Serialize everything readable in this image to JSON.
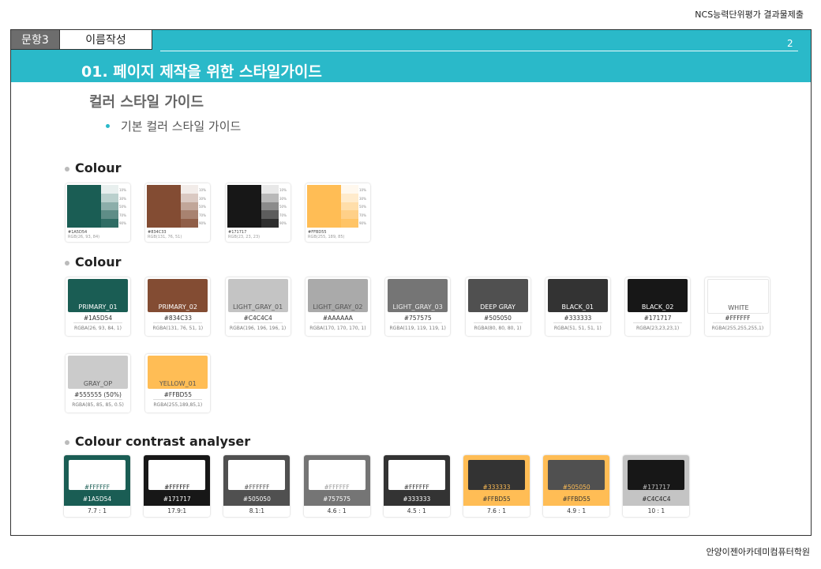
{
  "header": {
    "top_right": "NCS능력단위평가 결과물제출",
    "question_label": "문항3",
    "question_name": "이름작성",
    "page_number": "2",
    "title": "01. 페이지 제작을 위한 스타일가이드"
  },
  "section": {
    "title": "컬러 스타일 가이드",
    "bullet": "기본 컬러 스타일 가이드"
  },
  "footer": {
    "text": "안양이젠아카데미컴퓨터학원"
  },
  "guide": {
    "heading_palette": "Colour",
    "heading_swatches": "Colour",
    "heading_contrast": "Colour contrast analyser",
    "tint_labels": [
      "10%",
      "30%",
      "50%",
      "70%",
      "90%"
    ],
    "palettes": [
      {
        "hex": "#1A5D54",
        "rgb": "RGB(26, 93, 84)",
        "base": "#1A5D54",
        "tints": [
          "#e8efee",
          "#bad0cd",
          "#8caeaa",
          "#5e8d87",
          "#2f6c64"
        ]
      },
      {
        "hex": "#834C33",
        "rgb": "RGB(131, 76, 51)",
        "base": "#834C33",
        "tints": [
          "#f2ece9",
          "#dac9c2",
          "#c1a699",
          "#a88270",
          "#905e48"
        ]
      },
      {
        "hex": "#171717",
        "rgb": "RGB(23, 23, 23)",
        "base": "#171717",
        "tints": [
          "#e8e8e8",
          "#b9b9b9",
          "#8b8b8b",
          "#5d5d5d",
          "#2e2e2e"
        ]
      },
      {
        "hex": "#FFBD55",
        "rgb": "RGB(255, 189, 85)",
        "base": "#FFBD55",
        "tints": [
          "#fff8ee",
          "#ffebcc",
          "#ffdeaa",
          "#ffd088",
          "#ffc466"
        ]
      }
    ],
    "swatches": [
      {
        "name": "PRIMARY_01",
        "hex": "#1A5D54",
        "rgba": "RGBA(26, 93, 84, 1)",
        "color": "#1A5D54",
        "text": "#ffffff"
      },
      {
        "name": "PRIMARY_02",
        "hex": "#834C33",
        "rgba": "RGBA(131, 76, 51, 1)",
        "color": "#834C33",
        "text": "#ffffff"
      },
      {
        "name": "LIGHT_GRAY_01",
        "hex": "#C4C4C4",
        "rgba": "RGBA(196, 196, 196, 1)",
        "color": "#C4C4C4",
        "text": "#555555"
      },
      {
        "name": "LIGHT_GRAY_02",
        "hex": "#AAAAAA",
        "rgba": "RGBA(170, 170, 170, 1)",
        "color": "#AAAAAA",
        "text": "#555555"
      },
      {
        "name": "LIGHT_GRAY_03",
        "hex": "#757575",
        "rgba": "RGBA(119, 119, 119, 1)",
        "color": "#757575",
        "text": "#eeeeee"
      },
      {
        "name": "DEEP GRAY",
        "hex": "#505050",
        "rgba": "RGBA(80, 80, 80, 1)",
        "color": "#505050",
        "text": "#ffffff"
      },
      {
        "name": "BLACK_01",
        "hex": "#333333",
        "rgba": "RGBA(51, 51, 51, 1)",
        "color": "#333333",
        "text": "#ffffff"
      },
      {
        "name": "BLACK_02",
        "hex": "#171717",
        "rgba": "RGBA(23,23,23,1)",
        "color": "#171717",
        "text": "#ffffff"
      },
      {
        "name": "WHITE",
        "hex": "#FFFFFF",
        "rgba": "RGBA(255,255,255,1)",
        "color": "#FFFFFF",
        "text": "#555555"
      },
      {
        "name": "GRAY_OP",
        "hex": "#555555 (50%)",
        "rgba": "RGBA(85, 85, 85, 0.5)",
        "color": "#CBCBCB",
        "text": "#555555"
      },
      {
        "name": "YELLOW_01",
        "hex": "#FFBD55",
        "rgba": "RGBA(255,189,85,1)",
        "color": "#FFBD55",
        "text": "#555555"
      }
    ],
    "contrasts": [
      {
        "fg": "#FFFFFF",
        "bg": "#1A5D54",
        "ratio": "7.7 : 1",
        "fg_color": "#FFFFFF",
        "bg_color": "#1A5D54",
        "fg_text": "#1A5D54",
        "bg_text": "#FFFFFF"
      },
      {
        "fg": "#FFFFFF",
        "bg": "#171717",
        "ratio": "17.9:1",
        "fg_color": "#FFFFFF",
        "bg_color": "#171717",
        "fg_text": "#171717",
        "bg_text": "#FFFFFF"
      },
      {
        "fg": "#FFFFFF",
        "bg": "#505050",
        "ratio": "8.1:1",
        "fg_color": "#FFFFFF",
        "bg_color": "#505050",
        "fg_text": "#505050",
        "bg_text": "#FFFFFF"
      },
      {
        "fg": "#FFFFFF",
        "bg": "#757575",
        "ratio": "4.6 : 1",
        "fg_color": "#FFFFFF",
        "bg_color": "#757575",
        "fg_text": "#9a9a9a",
        "bg_text": "#FFFFFF"
      },
      {
        "fg": "#FFFFFF",
        "bg": "#333333",
        "ratio": "4.5 : 1",
        "fg_color": "#FFFFFF",
        "bg_color": "#333333",
        "fg_text": "#333333",
        "bg_text": "#FFFFFF"
      },
      {
        "fg": "#333333",
        "bg": "#FFBD55",
        "ratio": "7.6 : 1",
        "fg_color": "#333333",
        "bg_color": "#FFBD55",
        "fg_text": "#FFBD55",
        "bg_text": "#333333"
      },
      {
        "fg": "#505050",
        "bg": "#FFBD55",
        "ratio": "4.9 : 1",
        "fg_color": "#505050",
        "bg_color": "#FFBD55",
        "fg_text": "#FFBD55",
        "bg_text": "#333333"
      },
      {
        "fg": "#171717",
        "bg": "#C4C4C4",
        "ratio": "10 : 1",
        "fg_color": "#171717",
        "bg_color": "#C4C4C4",
        "fg_text": "#C4C4C4",
        "bg_text": "#222222"
      }
    ]
  }
}
